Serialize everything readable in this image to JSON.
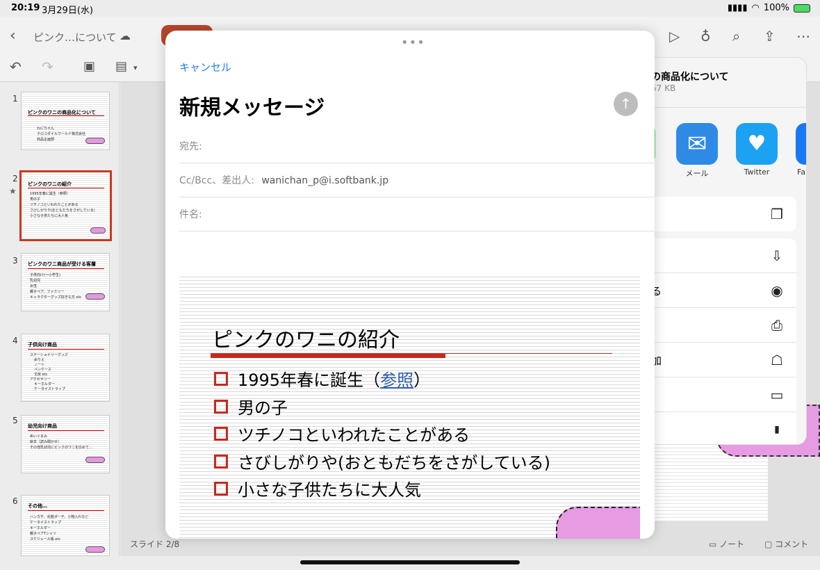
{
  "status_bar": {
    "time": "20:19",
    "date": "3月29日(水)",
    "battery": "100%"
  },
  "document": {
    "title": "ピンク…について"
  },
  "sidebar": {
    "slides": [
      {
        "num": "1",
        "title": "ピンクのワニの商品化について",
        "bullets": [
          "わにちゃん",
          "クロコダイルワールド株式会社",
          "商品企画部"
        ]
      },
      {
        "num": "2",
        "title": "ピンクのワニの紹介",
        "bullets": [
          "1995年春に誕生（参照）",
          "男の子",
          "ツチノコといわれたことがある",
          "さびしがりや(おともだちをさがしている)",
          "小さな子供たちに大人気"
        ]
      },
      {
        "num": "3",
        "title": "ピンクのワニ商品が受ける客層",
        "bullets": [
          "子供向け(～小学生)",
          "乳幼児",
          "女性",
          "親子ペア、ファミリー",
          "キャラクターグッズ好きな方 etc"
        ]
      },
      {
        "num": "4",
        "title": "子供向け商品",
        "bullets": [
          "ステーショナリーグッズ",
          "ぬりえ",
          "ノート",
          "ペンケース",
          "文房 etc",
          "アクセサリー",
          "キーホルダー",
          "ケータイストラップ"
        ]
      },
      {
        "num": "5",
        "title": "幼児向け商品",
        "bullets": [
          "ぬいぐるみ",
          "絵本（読み聞かせ）",
          "その他乳幼児にピンクのワニを広めて…"
        ]
      },
      {
        "num": "6",
        "title": "その他…",
        "bullets": [
          "ハンカチ、化粧ポーチ、小物入れなど",
          "ケータイストラップ",
          "キーホルダー",
          "親子ペアTシャツ",
          "スケジュール帳 etc"
        ]
      }
    ]
  },
  "bottom": {
    "slide_counter": "スライド 2/8",
    "notes": "ノート",
    "comments": "コメント"
  },
  "share_sheet": {
    "file_title": "の商品化について",
    "file_size": "57 KB",
    "apps": [
      {
        "label": "メール",
        "color": "#2f8ae6"
      },
      {
        "label": "Twitter",
        "color": "#1da1f2"
      },
      {
        "label": "Fa",
        "color": "#1877f2"
      }
    ],
    "actions": [
      {
        "label": "",
        "icon": "copy-icon"
      },
      {
        "label": "",
        "icon": "save-icon"
      },
      {
        "label": "る",
        "icon": "person-circle-icon"
      },
      {
        "label": "",
        "icon": "print-icon"
      },
      {
        "label": "加",
        "icon": "contact-add-icon"
      },
      {
        "label": "",
        "icon": "folder-icon"
      },
      {
        "label": "",
        "icon": "bookmark-icon"
      }
    ]
  },
  "compose": {
    "cancel": "キャンセル",
    "title": "新規メッセージ",
    "to_label": "宛先:",
    "cc_label": "Cc/Bcc、差出人:",
    "cc_value": "wanichan_p@i.softbank.jp",
    "subject_label": "件名:"
  },
  "preview": {
    "title": "ピンクのワニの紹介",
    "items": [
      {
        "pre": "1995年春に誕生（",
        "link": "参照",
        "post": "）"
      },
      {
        "pre": "男の子",
        "link": "",
        "post": ""
      },
      {
        "pre": "ツチノコといわれたことがある",
        "link": "",
        "post": ""
      },
      {
        "pre": "さびしがりや(おともだちをさがしている)",
        "link": "",
        "post": ""
      },
      {
        "pre": "小さな子供たちに大人気",
        "link": "",
        "post": ""
      }
    ]
  }
}
